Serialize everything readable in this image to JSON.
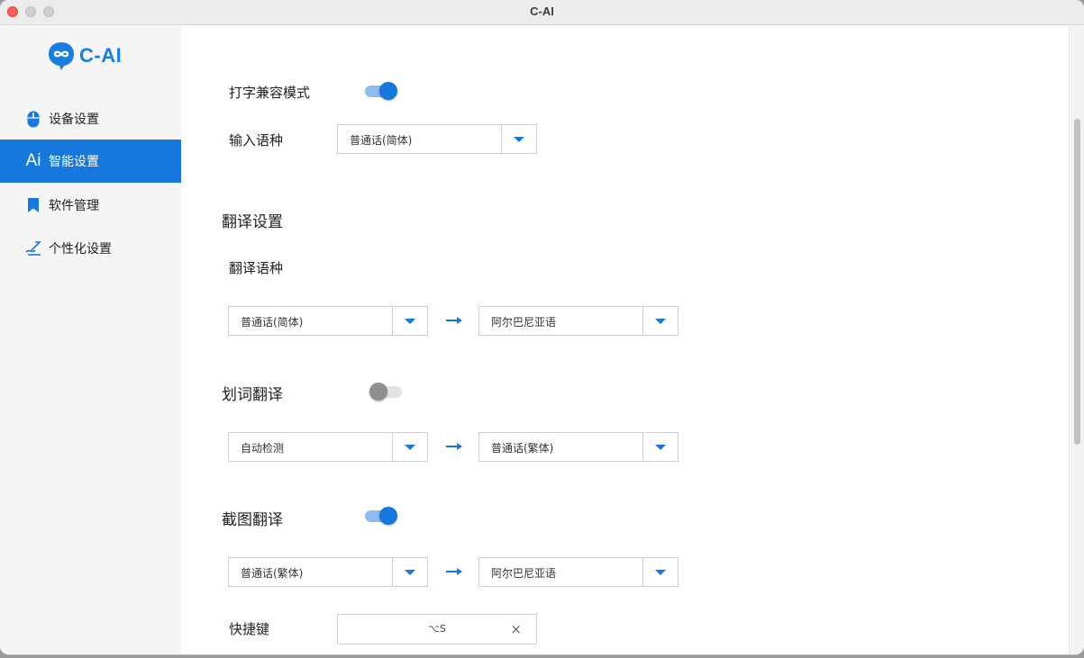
{
  "window": {
    "title": "C-AI"
  },
  "sidebar": {
    "logo_text": "C-AI",
    "items": [
      {
        "label": "设备设置",
        "icon": "mouse-icon",
        "active": false
      },
      {
        "label": "智能设置",
        "icon": "ai-icon",
        "icon_text": "Ai",
        "active": true
      },
      {
        "label": "软件管理",
        "icon": "bookmark-icon",
        "active": false
      },
      {
        "label": "个性化设置",
        "icon": "pen-icon",
        "active": false
      }
    ]
  },
  "settings": {
    "typing_compat": {
      "label": "打字兼容模式",
      "enabled": true
    },
    "input_lang": {
      "label": "输入语种",
      "value": "普通话(简体)"
    },
    "translate_section": {
      "title": "翻译设置"
    },
    "translate_lang": {
      "label": "翻译语种",
      "from": "普通话(简体)",
      "to": "阿尔巴尼亚语"
    },
    "word_translate": {
      "label": "划词翻译",
      "enabled": false,
      "from": "自动检测",
      "to": "普通话(繁体)"
    },
    "screenshot_translate": {
      "label": "截图翻译",
      "enabled": true,
      "from": "普通话(繁体)",
      "to": "阿尔巴尼亚语"
    },
    "hotkey": {
      "label": "快捷键",
      "value": "⌥S",
      "clear": "×"
    }
  },
  "colors": {
    "accent": "#1677dd",
    "toggle_track_on": "#8cbcf0",
    "sidebar_bg": "#f5f5f5"
  }
}
